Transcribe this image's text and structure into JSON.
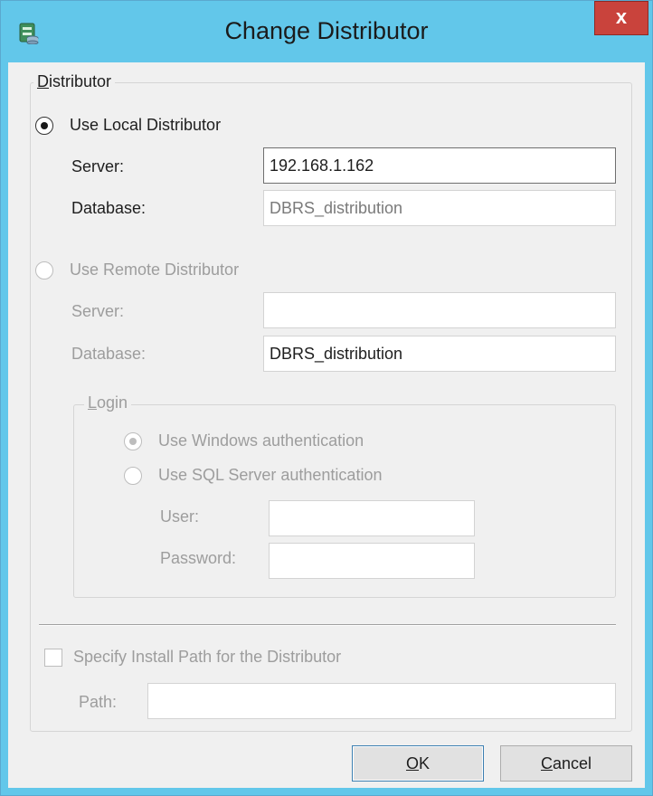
{
  "window": {
    "title": "Change Distributor",
    "close_glyph": "x",
    "app_icon": "database-server-icon"
  },
  "distributor_group": {
    "caption_underline": "D",
    "caption_rest": "istributor",
    "local": {
      "label": "Use Local Distributor",
      "selected": true,
      "server_label": "Server:",
      "server_value": "192.168.1.162",
      "database_label": "Database:",
      "database_value": "DBRS_distribution"
    },
    "remote": {
      "label": "Use Remote Distributor",
      "selected": false,
      "server_label": "Server:",
      "server_value": "",
      "database_label": "Database:",
      "database_value": "DBRS_distribution",
      "login": {
        "caption_underline": "L",
        "caption_rest": "ogin",
        "windows_auth_label": "Use Windows authentication",
        "windows_auth_selected": true,
        "sql_auth_label": "Use SQL Server authentication",
        "sql_auth_selected": false,
        "user_label": "User:",
        "user_value": "",
        "password_label": "Password:",
        "password_value": ""
      }
    },
    "install_path": {
      "checkbox_label": "Specify Install Path for the Distributor",
      "checked": false,
      "path_label": "Path:",
      "path_value": ""
    }
  },
  "buttons": {
    "ok_underline": "O",
    "ok_rest": "K",
    "cancel_underline": "C",
    "cancel_rest": "ancel"
  },
  "colors": {
    "titlebar": "#62c7ea",
    "close": "#c9433c",
    "client": "#f0f0f0"
  }
}
